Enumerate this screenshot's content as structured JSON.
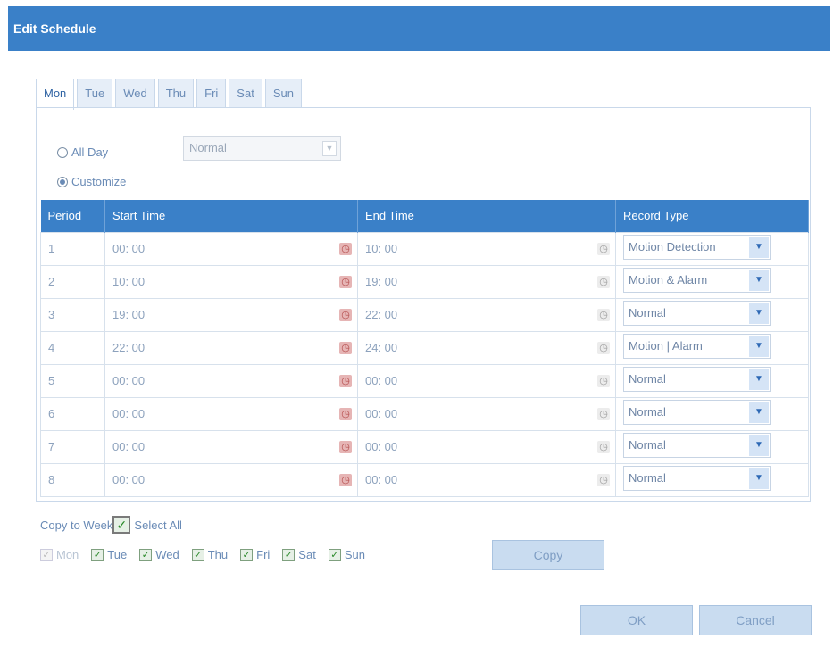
{
  "dialog": {
    "title": "Edit Schedule"
  },
  "tabs": [
    "Mon",
    "Tue",
    "Wed",
    "Thu",
    "Fri",
    "Sat",
    "Sun"
  ],
  "mode": {
    "all_day_label": "All Day",
    "customize_label": "Customize",
    "all_day_type": "Normal"
  },
  "table": {
    "headers": [
      "Period",
      "Start Time",
      "End Time",
      "Record Type"
    ],
    "rows": [
      {
        "period": "1",
        "start": "00: 00",
        "end": "10: 00",
        "type": "Motion Detection"
      },
      {
        "period": "2",
        "start": "10: 00",
        "end": "19: 00",
        "type": "Motion & Alarm"
      },
      {
        "period": "3",
        "start": "19: 00",
        "end": "22: 00",
        "type": "Normal"
      },
      {
        "period": "4",
        "start": "22: 00",
        "end": "24: 00",
        "type": "Motion | Alarm"
      },
      {
        "period": "5",
        "start": "00: 00",
        "end": "00: 00",
        "type": "Normal"
      },
      {
        "period": "6",
        "start": "00: 00",
        "end": "00: 00",
        "type": "Normal"
      },
      {
        "period": "7",
        "start": "00: 00",
        "end": "00: 00",
        "type": "Normal"
      },
      {
        "period": "8",
        "start": "00: 00",
        "end": "00: 00",
        "type": "Normal"
      }
    ]
  },
  "copy": {
    "copy_to_week_label": "Copy to Week",
    "select_all_label": "Select All",
    "days": [
      "Mon",
      "Tue",
      "Wed",
      "Thu",
      "Fri",
      "Sat",
      "Sun"
    ],
    "copy_button": "Copy"
  },
  "footer": {
    "ok": "OK",
    "cancel": "Cancel"
  }
}
